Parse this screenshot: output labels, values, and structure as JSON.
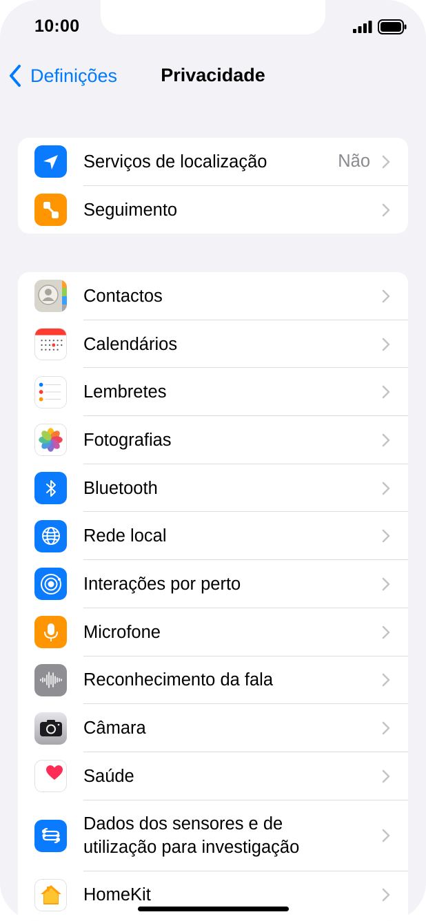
{
  "status": {
    "time": "10:00"
  },
  "nav": {
    "back_label": "Definições",
    "title": "Privacidade"
  },
  "group1": [
    {
      "label": "Serviços de localização",
      "value": "Não",
      "icon": "location-arrow-icon",
      "color": "#0a7aff"
    },
    {
      "label": "Seguimento",
      "icon": "tracking-icon",
      "color": "#ff9500"
    }
  ],
  "group2": [
    {
      "label": "Contactos",
      "icon": "contacts-icon"
    },
    {
      "label": "Calendários",
      "icon": "calendar-icon"
    },
    {
      "label": "Lembretes",
      "icon": "reminders-icon"
    },
    {
      "label": "Fotografias",
      "icon": "photos-icon"
    },
    {
      "label": "Bluetooth",
      "icon": "bluetooth-icon",
      "color": "#0a7aff"
    },
    {
      "label": "Rede local",
      "icon": "globe-icon",
      "color": "#0a7aff"
    },
    {
      "label": "Interações por perto",
      "icon": "nearby-interactions-icon",
      "color": "#0a7aff"
    },
    {
      "label": "Microfone",
      "icon": "microphone-icon",
      "color": "#ff9500"
    },
    {
      "label": "Reconhecimento da fala",
      "icon": "speech-waveform-icon",
      "color": "#8e8e93"
    },
    {
      "label": "Câmara",
      "icon": "camera-icon",
      "color": "#6d6d72"
    },
    {
      "label": "Saúde",
      "icon": "health-heart-icon"
    },
    {
      "label": "Dados dos sensores e de utilização para investigação",
      "icon": "research-sensor-icon",
      "color": "#0a7aff"
    },
    {
      "label": "HomeKit",
      "icon": "home-icon"
    }
  ]
}
